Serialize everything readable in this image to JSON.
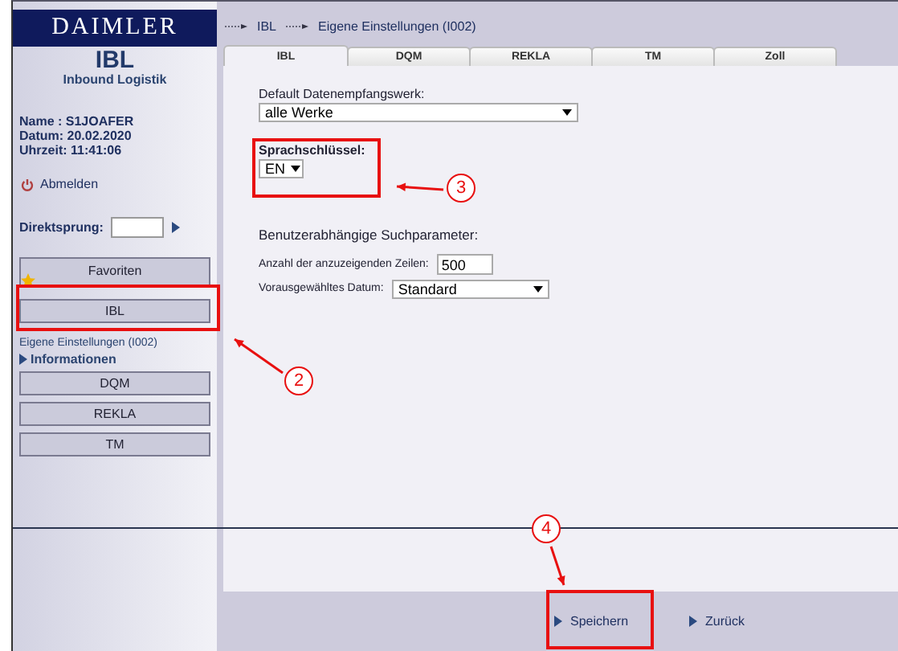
{
  "sidebar": {
    "brand": "DAIMLER",
    "app_title": "IBL",
    "app_subtitle": "Inbound Logistik",
    "user_info": [
      "Name : S1JOAFER",
      "Datum: 20.02.2020",
      "Uhrzeit: 11:41:06"
    ],
    "logout": "Abmelden",
    "jump_label": "Direktsprung:",
    "nav": [
      {
        "kind": "favorites",
        "label": "Favoriten"
      },
      {
        "kind": "button",
        "label": "IBL"
      },
      {
        "kind": "link",
        "label": "Eigene Einstellungen  (I002)"
      },
      {
        "kind": "section",
        "label": "Informationen"
      },
      {
        "kind": "button",
        "label": "DQM"
      },
      {
        "kind": "button",
        "label": "REKLA"
      },
      {
        "kind": "button",
        "label": "TM"
      }
    ]
  },
  "breadcrumb": [
    "IBL",
    "Eigene Einstellungen  (I002)"
  ],
  "tabs": [
    {
      "label": "IBL",
      "selected": true
    },
    {
      "label": "DQM",
      "selected": false
    },
    {
      "label": "REKLA",
      "selected": false
    },
    {
      "label": "TM",
      "selected": false
    },
    {
      "label": "Zoll",
      "selected": false
    }
  ],
  "form": [
    {
      "kind": "select",
      "label": "Default Datenempfangswerk:",
      "value": "alle Werke"
    },
    {
      "kind": "select-small",
      "label": "Sprachschlüssel:",
      "value": "EN"
    },
    {
      "kind": "heading",
      "label": "Benutzerabhängige Suchparameter:"
    },
    {
      "kind": "input",
      "label": "Anzahl der anzuzeigenden Zeilen:",
      "value": "500"
    },
    {
      "kind": "select-inline",
      "label": "Vorausgewähltes Datum:",
      "value": "Standard"
    }
  ],
  "footer_buttons": [
    "Speichern",
    "Zurück"
  ],
  "annotations": [
    {
      "label": "2"
    },
    {
      "label": "3"
    },
    {
      "label": "4"
    }
  ]
}
